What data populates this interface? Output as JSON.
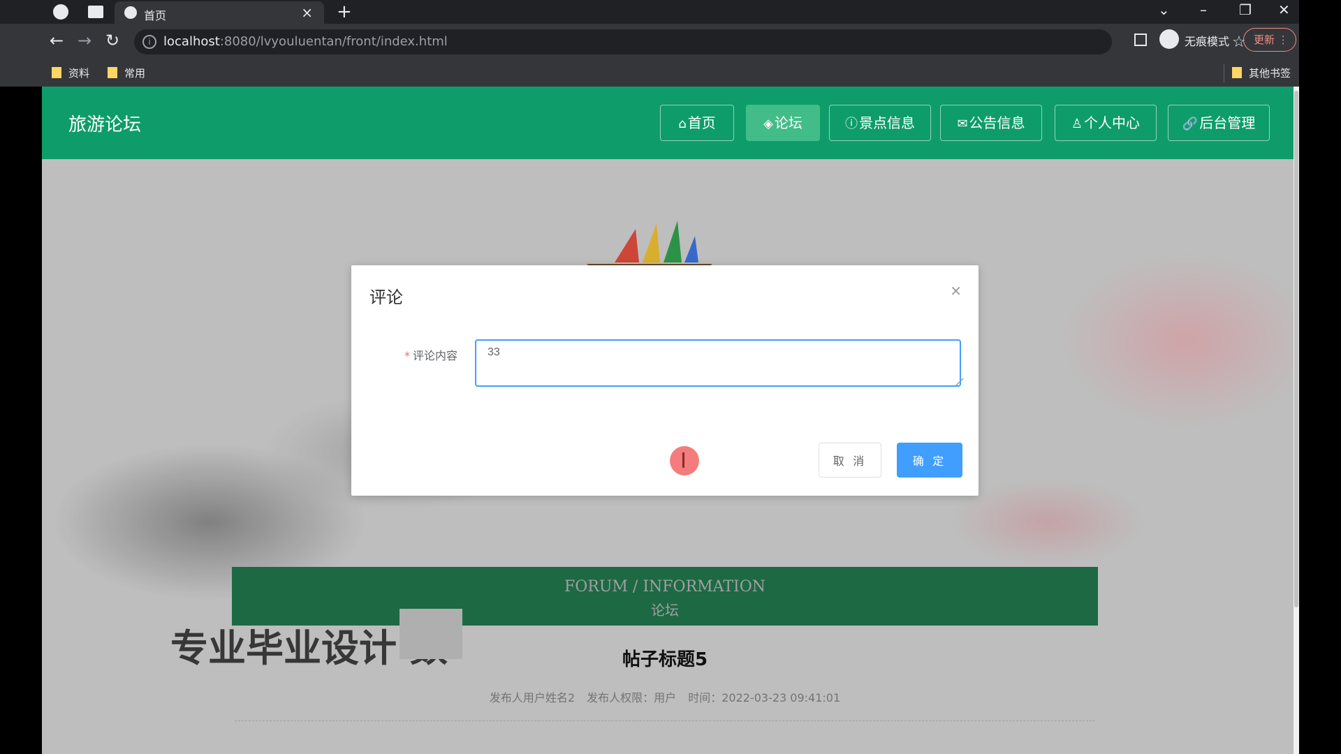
{
  "browser": {
    "tab_title": "首页",
    "tab_close": "×",
    "new_tab": "+",
    "url_host": "localhost",
    "url_rest": ":8080/lvyouluentan/front/index.html",
    "incognito_label": "无痕模式",
    "update_label": "更新",
    "window_min": "–",
    "window_restore": "❐",
    "window_close": "✕",
    "tab_dropdown": "⌄",
    "bookmarks": [
      {
        "label": "资料"
      },
      {
        "label": "常用"
      }
    ],
    "other_bookmarks": "其他书签"
  },
  "site": {
    "title": "旅游论坛",
    "accent": "#0e9d6a",
    "nav": [
      {
        "icon": "⌂",
        "label": "首页"
      },
      {
        "icon": "◈",
        "label": "论坛"
      },
      {
        "icon": "ⓘ",
        "label": "景点信息"
      },
      {
        "icon": "✉",
        "label": "公告信息"
      },
      {
        "icon": "♙",
        "label": "个人中心"
      },
      {
        "icon": "🔗",
        "label": "后台管理"
      }
    ]
  },
  "forum": {
    "band_en": "FORUM / INFORMATION",
    "band_cn": "论坛",
    "watermark": "专业毕业设计 数",
    "post_title": "帖子标题5",
    "meta_author": "发布人用户姓名2",
    "meta_role": "发布人权限：用户",
    "meta_time": "时间：2022-03-23 09:41:01",
    "carousel_active_index": 0
  },
  "dialog": {
    "title": "评论",
    "close": "×",
    "label": "评论内容",
    "required_mark": "*",
    "content": "33",
    "cancel": "取 消",
    "confirm": "确 定"
  }
}
